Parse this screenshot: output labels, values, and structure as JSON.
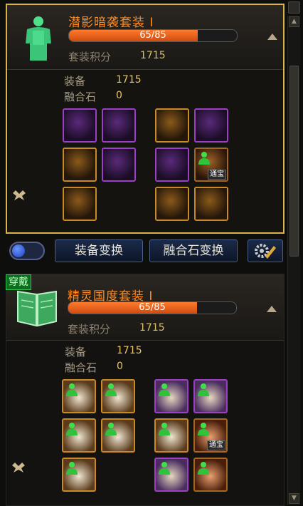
{
  "sets": [
    {
      "name": "潜影暗袭套装 I",
      "progress_text": "65/85",
      "progress_fraction": 0.765,
      "score_label": "套装积分",
      "score_value": "1715",
      "equip_label": "装备",
      "equip_value": "1715",
      "fusion_label": "融合石",
      "fusion_value": "0",
      "selected": true,
      "items": [
        {
          "name": "dark-hood-helmet",
          "rarity": "purple"
        },
        {
          "name": "dark-hood-shoulder",
          "rarity": "purple"
        },
        {
          "name": "orange-blade",
          "rarity": "legend"
        },
        {
          "name": "purple-staff",
          "rarity": "purple"
        },
        {
          "name": "black-pants",
          "rarity": "legend"
        },
        {
          "name": "purple-belt",
          "rarity": "purple"
        },
        {
          "name": "purple-boots",
          "rarity": "purple"
        },
        {
          "name": "character-card",
          "rarity": "red",
          "tag": "通宝"
        },
        {
          "name": "gold-bracelet",
          "rarity": "legend"
        },
        {
          "name": "lightning-stone",
          "rarity": "legend"
        },
        {
          "name": "dark-ring",
          "rarity": "legend"
        }
      ]
    },
    {
      "name": "精灵国度套装 I",
      "progress_text": "65/85",
      "progress_fraction": 0.765,
      "score_label": "套装积分",
      "score_value": "1715",
      "equip_label": "装备",
      "equip_value": "1715",
      "fusion_label": "融合石",
      "fusion_value": "0",
      "equipped_tag": "穿戴",
      "selected": false,
      "items": [
        {
          "name": "elf-helmet",
          "rarity": "legend"
        },
        {
          "name": "elf-cape",
          "rarity": "legend"
        },
        {
          "name": "elf-whip",
          "rarity": "purple"
        },
        {
          "name": "elf-bow",
          "rarity": "purple"
        },
        {
          "name": "elf-robe",
          "rarity": "legend"
        },
        {
          "name": "elf-belt",
          "rarity": "legend"
        },
        {
          "name": "elf-scroll",
          "rarity": "legend"
        },
        {
          "name": "elf-card",
          "rarity": "red",
          "tag": "通宝"
        },
        {
          "name": "elf-boots",
          "rarity": "legend"
        },
        {
          "name": "elf-bracelet",
          "rarity": "purple"
        },
        {
          "name": "elf-orb",
          "rarity": "red"
        }
      ]
    }
  ],
  "toolbar": {
    "equip_swap_label": "装备变换",
    "fusion_swap_label": "融合石变换",
    "settings_icon": "wrench-gear-icon",
    "toggle_state": "off"
  },
  "colors": {
    "set_name": "#ff8a1e",
    "progress_fill": "#e8621e",
    "selected_border": "#d9b34a",
    "button_bg": "#14213a"
  }
}
